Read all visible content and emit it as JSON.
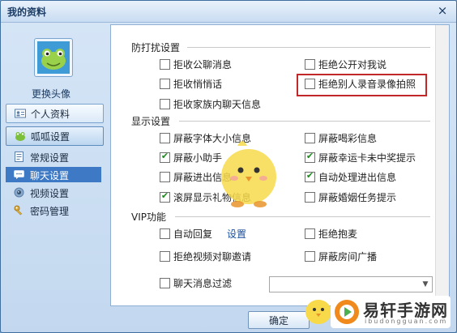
{
  "window": {
    "title": "我的资料",
    "close_glyph": "×"
  },
  "sidebar": {
    "change_avatar": "更换头像",
    "buttons": [
      {
        "label": "个人资料",
        "icon": "id-card-icon"
      },
      {
        "label": "呱呱设置",
        "icon": "frog-icon"
      }
    ],
    "sub_items": [
      {
        "label": "常规设置",
        "icon": "settings-doc-icon"
      },
      {
        "label": "聊天设置",
        "icon": "chat-settings-icon",
        "selected": true
      },
      {
        "label": "视频设置",
        "icon": "video-icon"
      },
      {
        "label": "密码管理",
        "icon": "key-icon"
      }
    ]
  },
  "panel": {
    "groups": {
      "anti": "防打扰设置",
      "display": "显示设置",
      "vip": "VIP功能"
    },
    "checkboxes": {
      "reject_public_msg": {
        "label": "拒收公聊消息",
        "checked": false
      },
      "reject_public_to_me": {
        "label": "拒绝公开对我说",
        "checked": false
      },
      "reject_whisper": {
        "label": "拒收悄悄话",
        "checked": false
      },
      "reject_record": {
        "label": "拒绝别人录音录像拍照",
        "checked": false
      },
      "reject_family_chat": {
        "label": "拒收家族内聊天信息",
        "checked": false
      },
      "block_font_size": {
        "label": "屏蔽字体大小信息",
        "checked": false
      },
      "block_cheer": {
        "label": "屏蔽喝彩信息",
        "checked": false
      },
      "block_helper": {
        "label": "屏蔽小助手",
        "checked": true
      },
      "block_lucky": {
        "label": "屏蔽幸运卡未中奖提示",
        "checked": true
      },
      "block_enter_exit": {
        "label": "屏蔽进出信息",
        "checked": false
      },
      "auto_enter_exit": {
        "label": "自动处理进出信息",
        "checked": true
      },
      "scroll_gift": {
        "label": "滚屏显示礼物信息",
        "checked": true
      },
      "block_marriage": {
        "label": "屏蔽婚姻任务提示",
        "checked": false
      },
      "auto_reply": {
        "label": "自动回复",
        "checked": false
      },
      "reject_hug": {
        "label": "拒绝抱麦",
        "checked": false
      },
      "reject_video_invite": {
        "label": "拒绝视频对聊邀请",
        "checked": false
      },
      "block_broadcast": {
        "label": "屏蔽房间广播",
        "checked": false
      },
      "chat_filter": {
        "label": "聊天消息过滤",
        "checked": false
      }
    },
    "auto_reply_setting": "设置",
    "filter_select": {
      "value": "",
      "arrow": "▼"
    }
  },
  "footer": {
    "ok_label": "确定"
  },
  "watermark": {
    "name": "易轩手游网",
    "url": "ibudongguan.com"
  },
  "colors": {
    "accent": "#3d79c4",
    "highlight": "#c0282a",
    "check": "#1c8a1c"
  }
}
